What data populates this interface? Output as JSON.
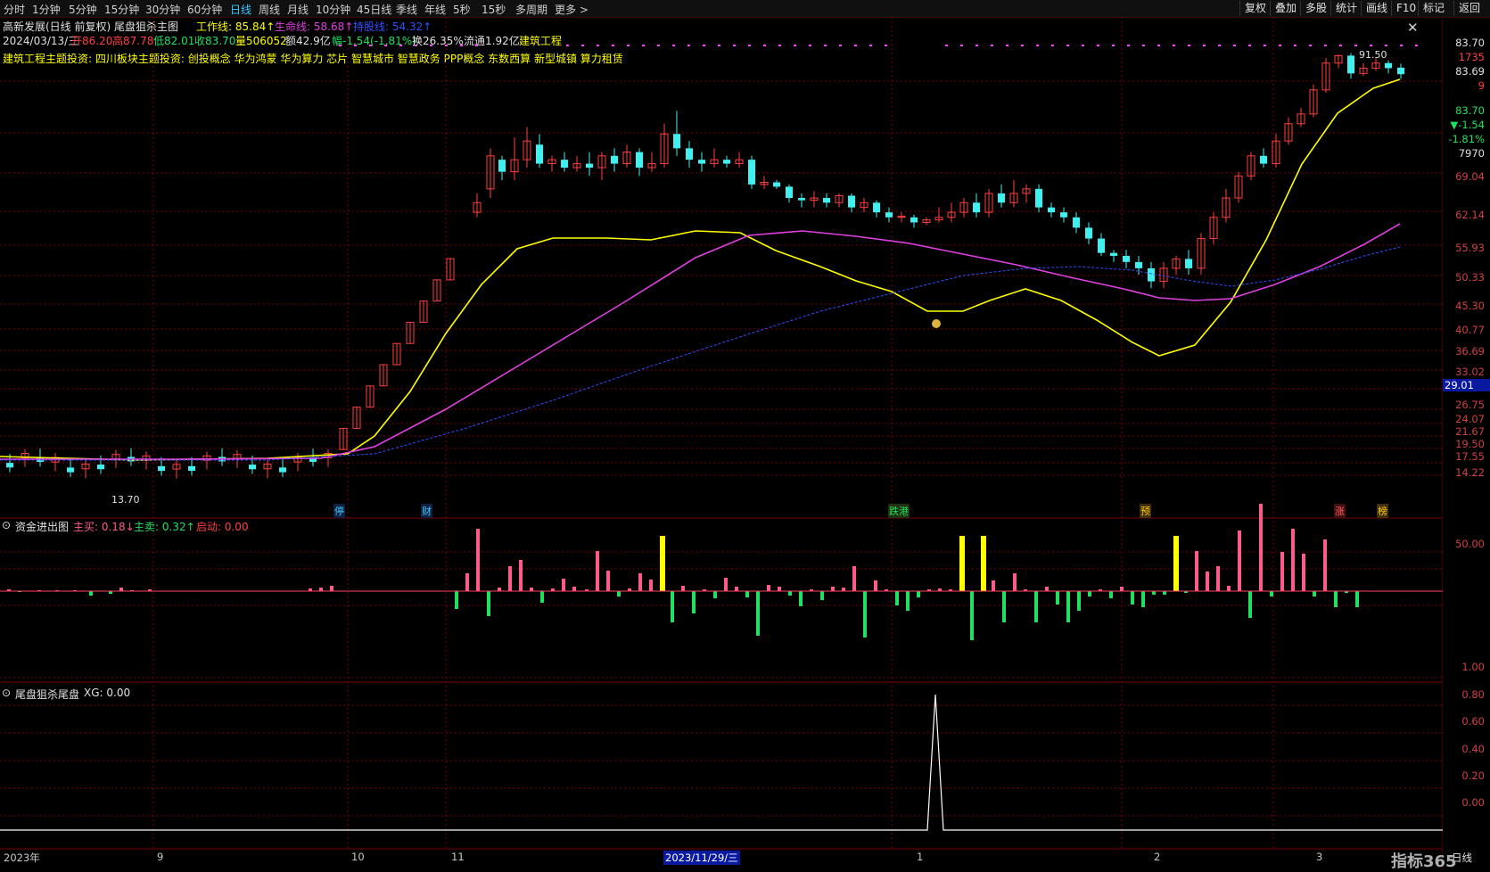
{
  "toolbar": {
    "tabs": [
      "分时",
      "1分钟",
      "5分钟",
      "15分钟",
      "30分钟",
      "60分钟",
      "日线",
      "周线",
      "月线",
      "10分钟",
      "45日线",
      "季线",
      "年线",
      "5秒",
      "15秒",
      "多周期",
      "更多 >"
    ],
    "active_tab": "日线",
    "right_buttons": [
      "复权",
      "叠加",
      "多股",
      "统计",
      "画线",
      "F10",
      "标记",
      "返回"
    ]
  },
  "header": {
    "stock_name": "高新发展(日线 前复权)",
    "indicator_name": "尾盘狙杀主图",
    "work_line": "工作线: 85.84↑",
    "life_line": "生命线: 58.68↑",
    "blue_line": "持股线: 54.32↑",
    "date": "2024/03/13/三",
    "open": "开86.20",
    "high": "高87.78",
    "low": "低82.01",
    "close": "收83.70",
    "volume": "量506052",
    "amount": "额42.9亿",
    "change": "幅-1.54(-1.81%)",
    "turnover": "换26.35%",
    "float": "流通1.92亿",
    "sector": "建筑工程",
    "concepts": "建筑工程主题投资: 四川板块主题投资: 创投概念 华为鸿蒙 华为算力 芯片 智慧城市 智慧政务 PPP概念 东数西算 新型城镇 算力租赁"
  },
  "price_axis": [
    "83.70",
    "1735",
    "83.69",
    "9",
    "83.70",
    "▼-1.54",
    "-1.81%",
    "7970",
    "69.04",
    "62.14",
    "55.93",
    "50.33",
    "45.30",
    "40.77",
    "36.69",
    "33.02",
    "29.01",
    "26.75",
    "24.07",
    "21.67",
    "19.50",
    "17.55",
    "14.22"
  ],
  "annotations": {
    "max_price": "91.50",
    "min_price": "13.70"
  },
  "signals": [
    "停",
    "财",
    "跌港",
    "预",
    "涨",
    "榜"
  ],
  "panel2": {
    "title": "资金进出图",
    "main_buy": "主买: 0.18↓",
    "main_sell": "主卖: 0.32↑",
    "start": "启动: 0.00",
    "axis": [
      "50.00"
    ]
  },
  "panel3": {
    "title": "尾盘狙杀尾盘",
    "xg": "XG: 0.00",
    "axis": [
      "1.00",
      "0.80",
      "0.60",
      "0.40",
      "0.20",
      "0.00"
    ]
  },
  "x_axis": [
    "2023年",
    "9",
    "10",
    "11",
    "2023/11/29/三",
    "1",
    "2",
    "3"
  ],
  "period_label": "日线",
  "brand": "指标365",
  "colors": {
    "up": "#ff4040",
    "down": "#3ff0f0",
    "work_line": "#ffff00",
    "life_line": "#e040e0",
    "hold_line": "#3050ff",
    "grid": "#7a0000",
    "buy_bar": "#ff5a8c",
    "sell_bar": "#20e060",
    "yellow_bar": "#ffff00"
  }
}
